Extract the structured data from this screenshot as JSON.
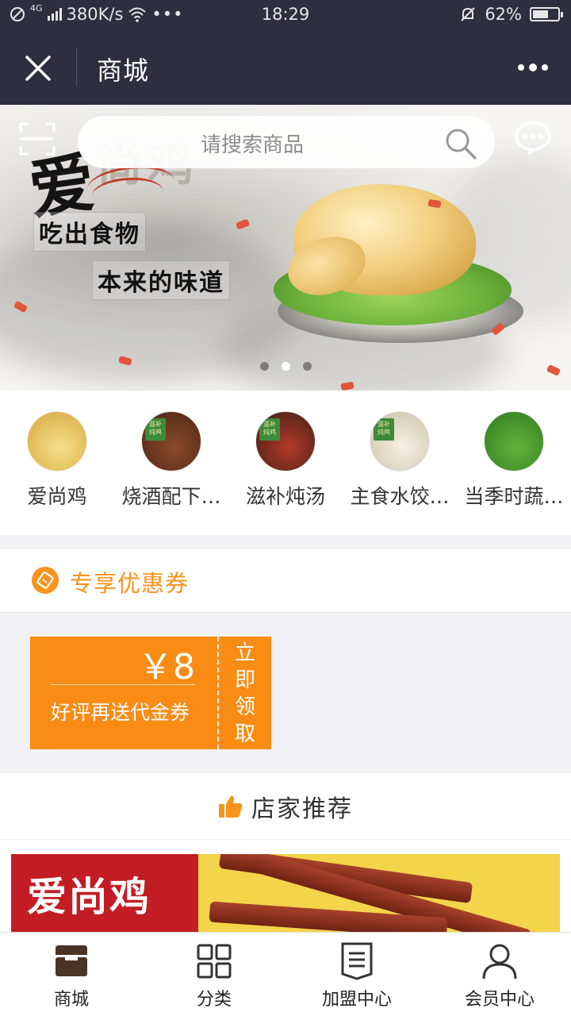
{
  "status_bar": {
    "network": "4G",
    "speed": "380K/s",
    "time": "18:29",
    "battery": "62%",
    "battery_level": 0.62
  },
  "title_bar": {
    "title": "商城"
  },
  "search": {
    "placeholder": "请搜索商品"
  },
  "banner": {
    "slide_count": 3,
    "active_slide": 1,
    "text_brand": "爱",
    "text_ghost": "尚鸡",
    "line1": "吃出食物",
    "line2": "本来的味道"
  },
  "categories": [
    {
      "label": "爱尚鸡",
      "badge": "",
      "colors": [
        "#f4e08a",
        "#d6a53c"
      ]
    },
    {
      "label": "烧酒配下…",
      "badge": "滋补\n炖鸡",
      "colors": [
        "#8b4a2b",
        "#4a2414"
      ]
    },
    {
      "label": "滋补炖汤",
      "badge": "滋补\n炖鸡",
      "colors": [
        "#b13a2a",
        "#3d1d12"
      ]
    },
    {
      "label": "主食水饺…",
      "badge": "滋补\n炖鸡",
      "colors": [
        "#f5f0e3",
        "#c9bfa6"
      ]
    },
    {
      "label": "当季时蔬…",
      "badge": "",
      "colors": [
        "#63b23d",
        "#2f7a1e"
      ]
    }
  ],
  "coupon_section": {
    "title": "专享优惠券",
    "coupon": {
      "amount": "￥8",
      "description": "好评再送代金券",
      "claim_label": "立即领取"
    }
  },
  "recommend": {
    "title": "店家推荐",
    "banner_brand": "爱尚鸡"
  },
  "bottom_nav": [
    {
      "label": "商城",
      "icon": "shop-icon",
      "active": true
    },
    {
      "label": "分类",
      "icon": "grid-icon",
      "active": false
    },
    {
      "label": "加盟中心",
      "icon": "document-icon",
      "active": false
    },
    {
      "label": "会员中心",
      "icon": "user-icon",
      "active": false
    }
  ],
  "colors": {
    "header_bg": "#2d2e3f",
    "accent": "#f7941d",
    "coupon_bg": "#f98c14"
  }
}
